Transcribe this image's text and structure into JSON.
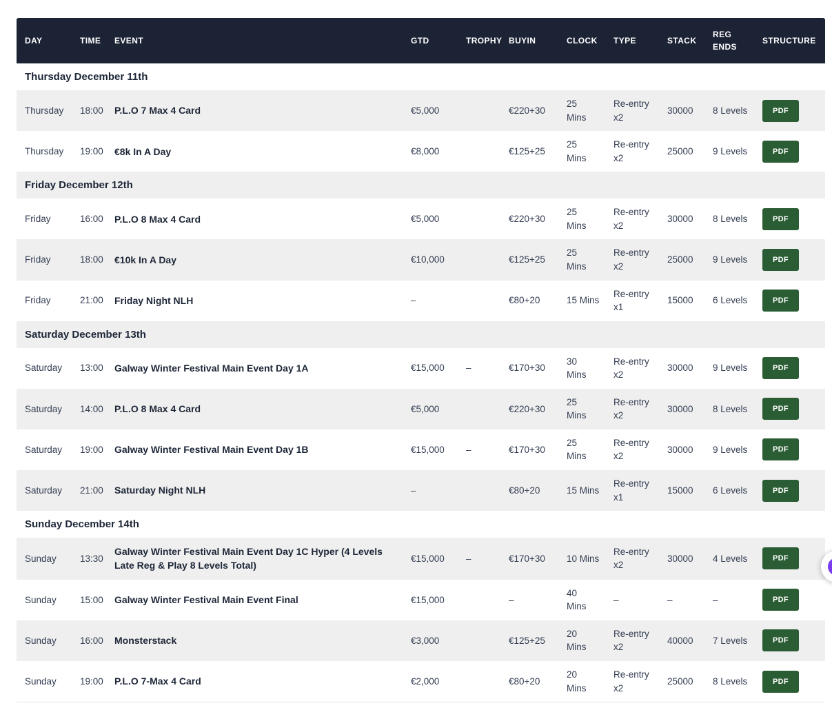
{
  "colors": {
    "header_bg": "#1c2335",
    "header_text": "#ffffff",
    "row_alt_bg": "#efefef",
    "body_text": "#333d52",
    "bold_text": "#1d2637",
    "pdf_button_bg": "#2b5d34",
    "widget_purple": "#7a3cf0"
  },
  "table": {
    "columns": [
      {
        "key": "day",
        "label": "DAY"
      },
      {
        "key": "time",
        "label": "TIME"
      },
      {
        "key": "event",
        "label": "EVENT"
      },
      {
        "key": "gtd",
        "label": "GTD"
      },
      {
        "key": "trophy",
        "label": "TROPHY"
      },
      {
        "key": "buyin",
        "label": "BUYIN"
      },
      {
        "key": "clock",
        "label": "CLOCK"
      },
      {
        "key": "type",
        "label": "TYPE"
      },
      {
        "key": "stack",
        "label": "STACK"
      },
      {
        "key": "reg_ends",
        "label": "REG ENDS"
      },
      {
        "key": "structure",
        "label": "STRUCTURE"
      }
    ],
    "sections": [
      {
        "title": "Thursday December 11th",
        "rows": [
          {
            "day": "Thursday",
            "time": "18:00",
            "event": "P.L.O 7 Max 4 Card",
            "gtd": "€5,000",
            "trophy": "",
            "buyin": "€220+30",
            "clock": "25\nMins",
            "type": "Re-entry x2",
            "stack": "30000",
            "reg_ends": "8 Levels",
            "structure": "PDF"
          },
          {
            "day": "Thursday",
            "time": "19:00",
            "event": "€8k In A Day",
            "gtd": "€8,000",
            "trophy": "",
            "buyin": "€125+25",
            "clock": "25\nMins",
            "type": "Re-entry x2",
            "stack": "25000",
            "reg_ends": "9 Levels",
            "structure": "PDF"
          }
        ]
      },
      {
        "title": "Friday December 12th",
        "rows": [
          {
            "day": "Friday",
            "time": "16:00",
            "event": "P.L.O 8 Max 4 Card",
            "gtd": "€5,000",
            "trophy": "",
            "buyin": "€220+30",
            "clock": "25\nMins",
            "type": "Re-entry x2",
            "stack": "30000",
            "reg_ends": "8 Levels",
            "structure": "PDF"
          },
          {
            "day": "Friday",
            "time": "18:00",
            "event": "€10k In A Day",
            "gtd": "€10,000",
            "trophy": "",
            "buyin": "€125+25",
            "clock": "25\nMins",
            "type": "Re-entry x2",
            "stack": "25000",
            "reg_ends": "9 Levels",
            "structure": "PDF"
          },
          {
            "day": "Friday",
            "time": "21:00",
            "event": "Friday Night NLH",
            "gtd": "–",
            "trophy": "",
            "buyin": "€80+20",
            "clock": "15 Mins",
            "type": "Re-entry x1",
            "stack": "15000",
            "reg_ends": "6 Levels",
            "structure": "PDF"
          }
        ]
      },
      {
        "title": "Saturday December 13th",
        "rows": [
          {
            "day": "Saturday",
            "time": "13:00",
            "event": "Galway Winter Festival Main Event Day 1A",
            "gtd": "€15,000",
            "trophy": "–",
            "buyin": "€170+30",
            "clock": "30\nMins",
            "type": "Re-entry x2",
            "stack": "30000",
            "reg_ends": "9 Levels",
            "structure": "PDF"
          },
          {
            "day": "Saturday",
            "time": "14:00",
            "event": "P.L.O 8 Max 4 Card",
            "gtd": "€5,000",
            "trophy": "",
            "buyin": "€220+30",
            "clock": "25\nMins",
            "type": "Re-entry x2",
            "stack": "30000",
            "reg_ends": "8 Levels",
            "structure": "PDF"
          },
          {
            "day": "Saturday",
            "time": "19:00",
            "event": "Galway Winter Festival Main Event Day 1B",
            "gtd": "€15,000",
            "trophy": "–",
            "buyin": "€170+30",
            "clock": "25\nMins",
            "type": "Re-entry x2",
            "stack": "30000",
            "reg_ends": "9 Levels",
            "structure": "PDF"
          },
          {
            "day": "Saturday",
            "time": "21:00",
            "event": "Saturday Night NLH",
            "gtd": "–",
            "trophy": "",
            "buyin": "€80+20",
            "clock": "15 Mins",
            "type": "Re-entry x1",
            "stack": "15000",
            "reg_ends": "6 Levels",
            "structure": "PDF"
          }
        ]
      },
      {
        "title": "Sunday December 14th",
        "rows": [
          {
            "day": "Sunday",
            "time": "13:30",
            "event": "Galway Winter Festival Main Event Day 1C Hyper (4 Levels Late Reg & Play 8 Levels Total)",
            "gtd": "€15,000",
            "trophy": "–",
            "buyin": "€170+30",
            "clock": "10 Mins",
            "type": "Re-entry x2",
            "stack": "30000",
            "reg_ends": "4 Levels",
            "structure": "PDF"
          },
          {
            "day": "Sunday",
            "time": "15:00",
            "event": "Galway Winter Festival Main Event Final",
            "gtd": "€15,000",
            "trophy": "",
            "buyin": "–",
            "clock": "40\nMins",
            "type": "–",
            "stack": "–",
            "reg_ends": "–",
            "structure": "PDF"
          },
          {
            "day": "Sunday",
            "time": "16:00",
            "event": "Monsterstack",
            "gtd": "€3,000",
            "trophy": "",
            "buyin": "€125+25",
            "clock": "20\nMins",
            "type": "Re-entry x2",
            "stack": "40000",
            "reg_ends": "7 Levels",
            "structure": "PDF"
          },
          {
            "day": "Sunday",
            "time": "19:00",
            "event": "P.L.O 7-Max 4 Card",
            "gtd": "€2,000",
            "trophy": "",
            "buyin": "€80+20",
            "clock": "20\nMins",
            "type": "Re-entry x2",
            "stack": "25000",
            "reg_ends": "8 Levels",
            "structure": "PDF"
          }
        ]
      }
    ]
  },
  "floating_widget": {
    "description": "accessibility widget button, partially visible at right edge"
  }
}
